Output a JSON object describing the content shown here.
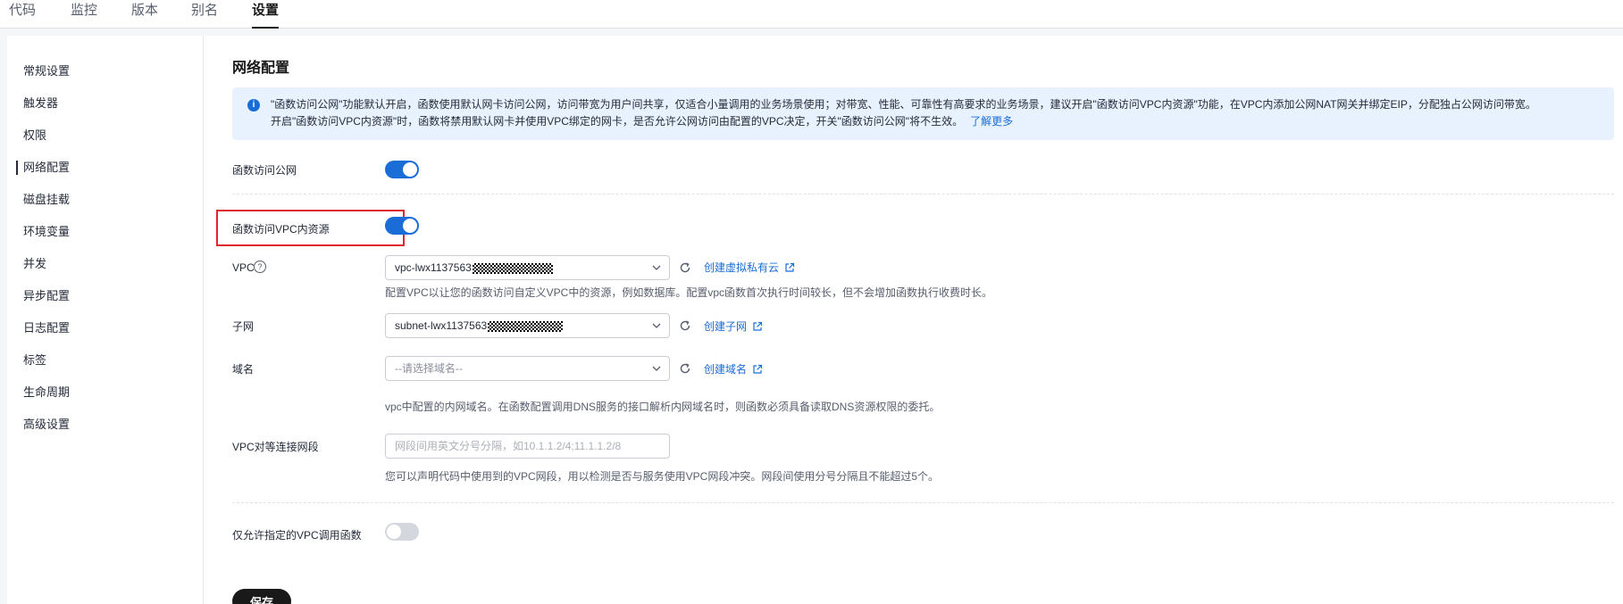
{
  "tabs": [
    {
      "label": "代码"
    },
    {
      "label": "监控"
    },
    {
      "label": "版本"
    },
    {
      "label": "别名"
    },
    {
      "label": "设置",
      "active": true
    }
  ],
  "sidebar": {
    "active": "网络配置",
    "items": [
      {
        "label": "常规设置"
      },
      {
        "label": "触发器"
      },
      {
        "label": "权限"
      },
      {
        "label": "网络配置"
      },
      {
        "label": "磁盘挂载"
      },
      {
        "label": "环境变量"
      },
      {
        "label": "并发"
      },
      {
        "label": "异步配置"
      },
      {
        "label": "日志配置"
      },
      {
        "label": "标签"
      },
      {
        "label": "生命周期"
      },
      {
        "label": "高级设置"
      }
    ]
  },
  "section": {
    "title": "网络配置"
  },
  "notice": {
    "line1": "\"函数访问公网\"功能默认开启，函数使用默认网卡访问公网，访问带宽为用户间共享，仅适合小量调用的业务场景使用；对带宽、性能、可靠性有高要求的业务场景，建议开启\"函数访问VPC内资源\"功能，在VPC内添加公网NAT网关并绑定EIP，分配独占公网访问带宽。",
    "line2": "开启\"函数访问VPC内资源\"时，函数将禁用默认网卡并使用VPC绑定的网卡，是否允许公网访问由配置的VPC决定，开关\"函数访问公网\"将不生效。",
    "learn_more": "了解更多"
  },
  "form": {
    "public_access": {
      "label": "函数访问公网",
      "enabled": true
    },
    "vpc_access": {
      "label": "函数访问VPC内资源",
      "enabled": true
    },
    "vpc": {
      "label": "VPC",
      "value": "vpc-lwx1137563",
      "link": "创建虚拟私有云",
      "hint": "配置VPC以让您的函数访问自定义VPC中的资源，例如数据库。配置vpc函数首次执行时间较长，但不会增加函数执行收费时长。"
    },
    "subnet": {
      "label": "子网",
      "value": "subnet-lwx1137563",
      "link": "创建子网"
    },
    "domain": {
      "label": "域名",
      "placeholder": "--请选择域名--",
      "link": "创建域名",
      "hint": "vpc中配置的内网域名。在函数配置调用DNS服务的接口解析内网域名时，则函数必须具备读取DNS资源权限的委托。"
    },
    "peering": {
      "label": "VPC对等连接网段",
      "placeholder": "网段间用英文分号分隔，如10.1.1.2/4;11.1.1.2/8",
      "value": "",
      "hint": "您可以声明代码中使用到的VPC网段，用以检测是否与服务使用VPC网段冲突。网段间使用分号分隔且不能超过5个。"
    },
    "restrict_vpc": {
      "label": "仅允许指定的VPC调用函数",
      "enabled": false
    },
    "save_label": "保存"
  },
  "colors": {
    "accent": "#1a6dd6",
    "highlight_border": "#e0262f",
    "primary_button": "#191919"
  }
}
